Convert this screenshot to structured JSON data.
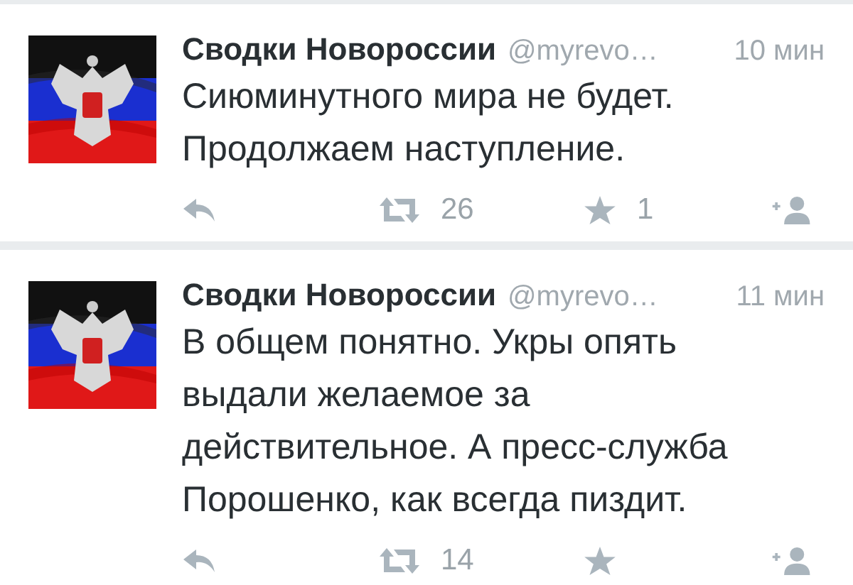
{
  "tweets": [
    {
      "author": "Сводки Новороссии",
      "handle": "@myrevo…",
      "time": "10 мин",
      "text": "Сиюминутного мира не будет. Продолжаем наступление.",
      "retweets": "26",
      "favorites": "1"
    },
    {
      "author": "Сводки Новороссии",
      "handle": "@myrevo…",
      "time": "11 мин",
      "text": "В общем понятно. Укры опять выдали желаемое за действительное. А пресс-служба Порошенко, как всегда пиздит.",
      "retweets": "14"
    }
  ]
}
